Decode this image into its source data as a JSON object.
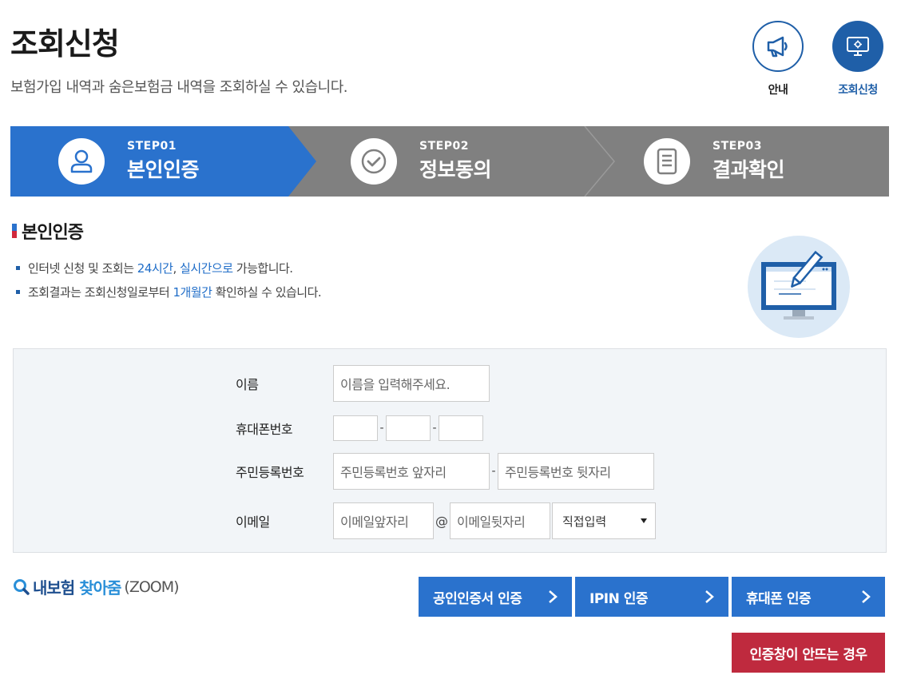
{
  "header": {
    "title": "조회신청",
    "subtitle": "보험가입 내역과 숨은보험금 내역을 조회하실 수 있습니다."
  },
  "top_buttons": {
    "guide": {
      "label": "안내",
      "icon": "megaphone-icon"
    },
    "inquiry": {
      "label": "조회신청",
      "icon": "monitor-gear-icon"
    }
  },
  "steps": [
    {
      "num": "STEP01",
      "name": "본인인증",
      "icon": "user-icon",
      "active": true
    },
    {
      "num": "STEP02",
      "name": "정보동의",
      "icon": "check-circle-icon",
      "active": false
    },
    {
      "num": "STEP03",
      "name": "결과확인",
      "icon": "document-icon",
      "active": false
    }
  ],
  "section": {
    "title": "본인인증",
    "note1": {
      "a": "인터넷 신청 및 조회는 ",
      "b": "24시간",
      "c": ", ",
      "d": "실시간으로",
      "e": " 가능합니다."
    },
    "note2": {
      "a": "조회결과는 조회신청일로부터 ",
      "b": "1개월간",
      "c": " 확인하실 수 있습니다."
    }
  },
  "form": {
    "name_label": "이름",
    "name_placeholder": "이름을 입력해주세요.",
    "phone_label": "휴대폰번호",
    "phone_sep": "-",
    "rrn_label": "주민등록번호",
    "rrn_front_placeholder": "주민등록번호 앞자리",
    "rrn_back_placeholder": "주민등록번호 뒷자리",
    "rrn_sep": "-",
    "email_label": "이메일",
    "email_local_placeholder": "이메일앞자리",
    "email_at": "@",
    "email_domain_placeholder": "이메일뒷자리",
    "email_select": "직접입력"
  },
  "zoom": {
    "a": "내보험",
    "b": "찾아줌",
    "c": "(ZOOM)"
  },
  "auth_buttons": {
    "cert": "공인인증서 인증",
    "ipin": "IPIN 인증",
    "phone": "휴대폰 인증"
  },
  "help_button": "인증창이 안뜨는 경우",
  "colors": {
    "primary": "#2a72cd",
    "navy": "#1f5fa8",
    "step_inactive": "#808080",
    "help": "#bf2a3e"
  }
}
